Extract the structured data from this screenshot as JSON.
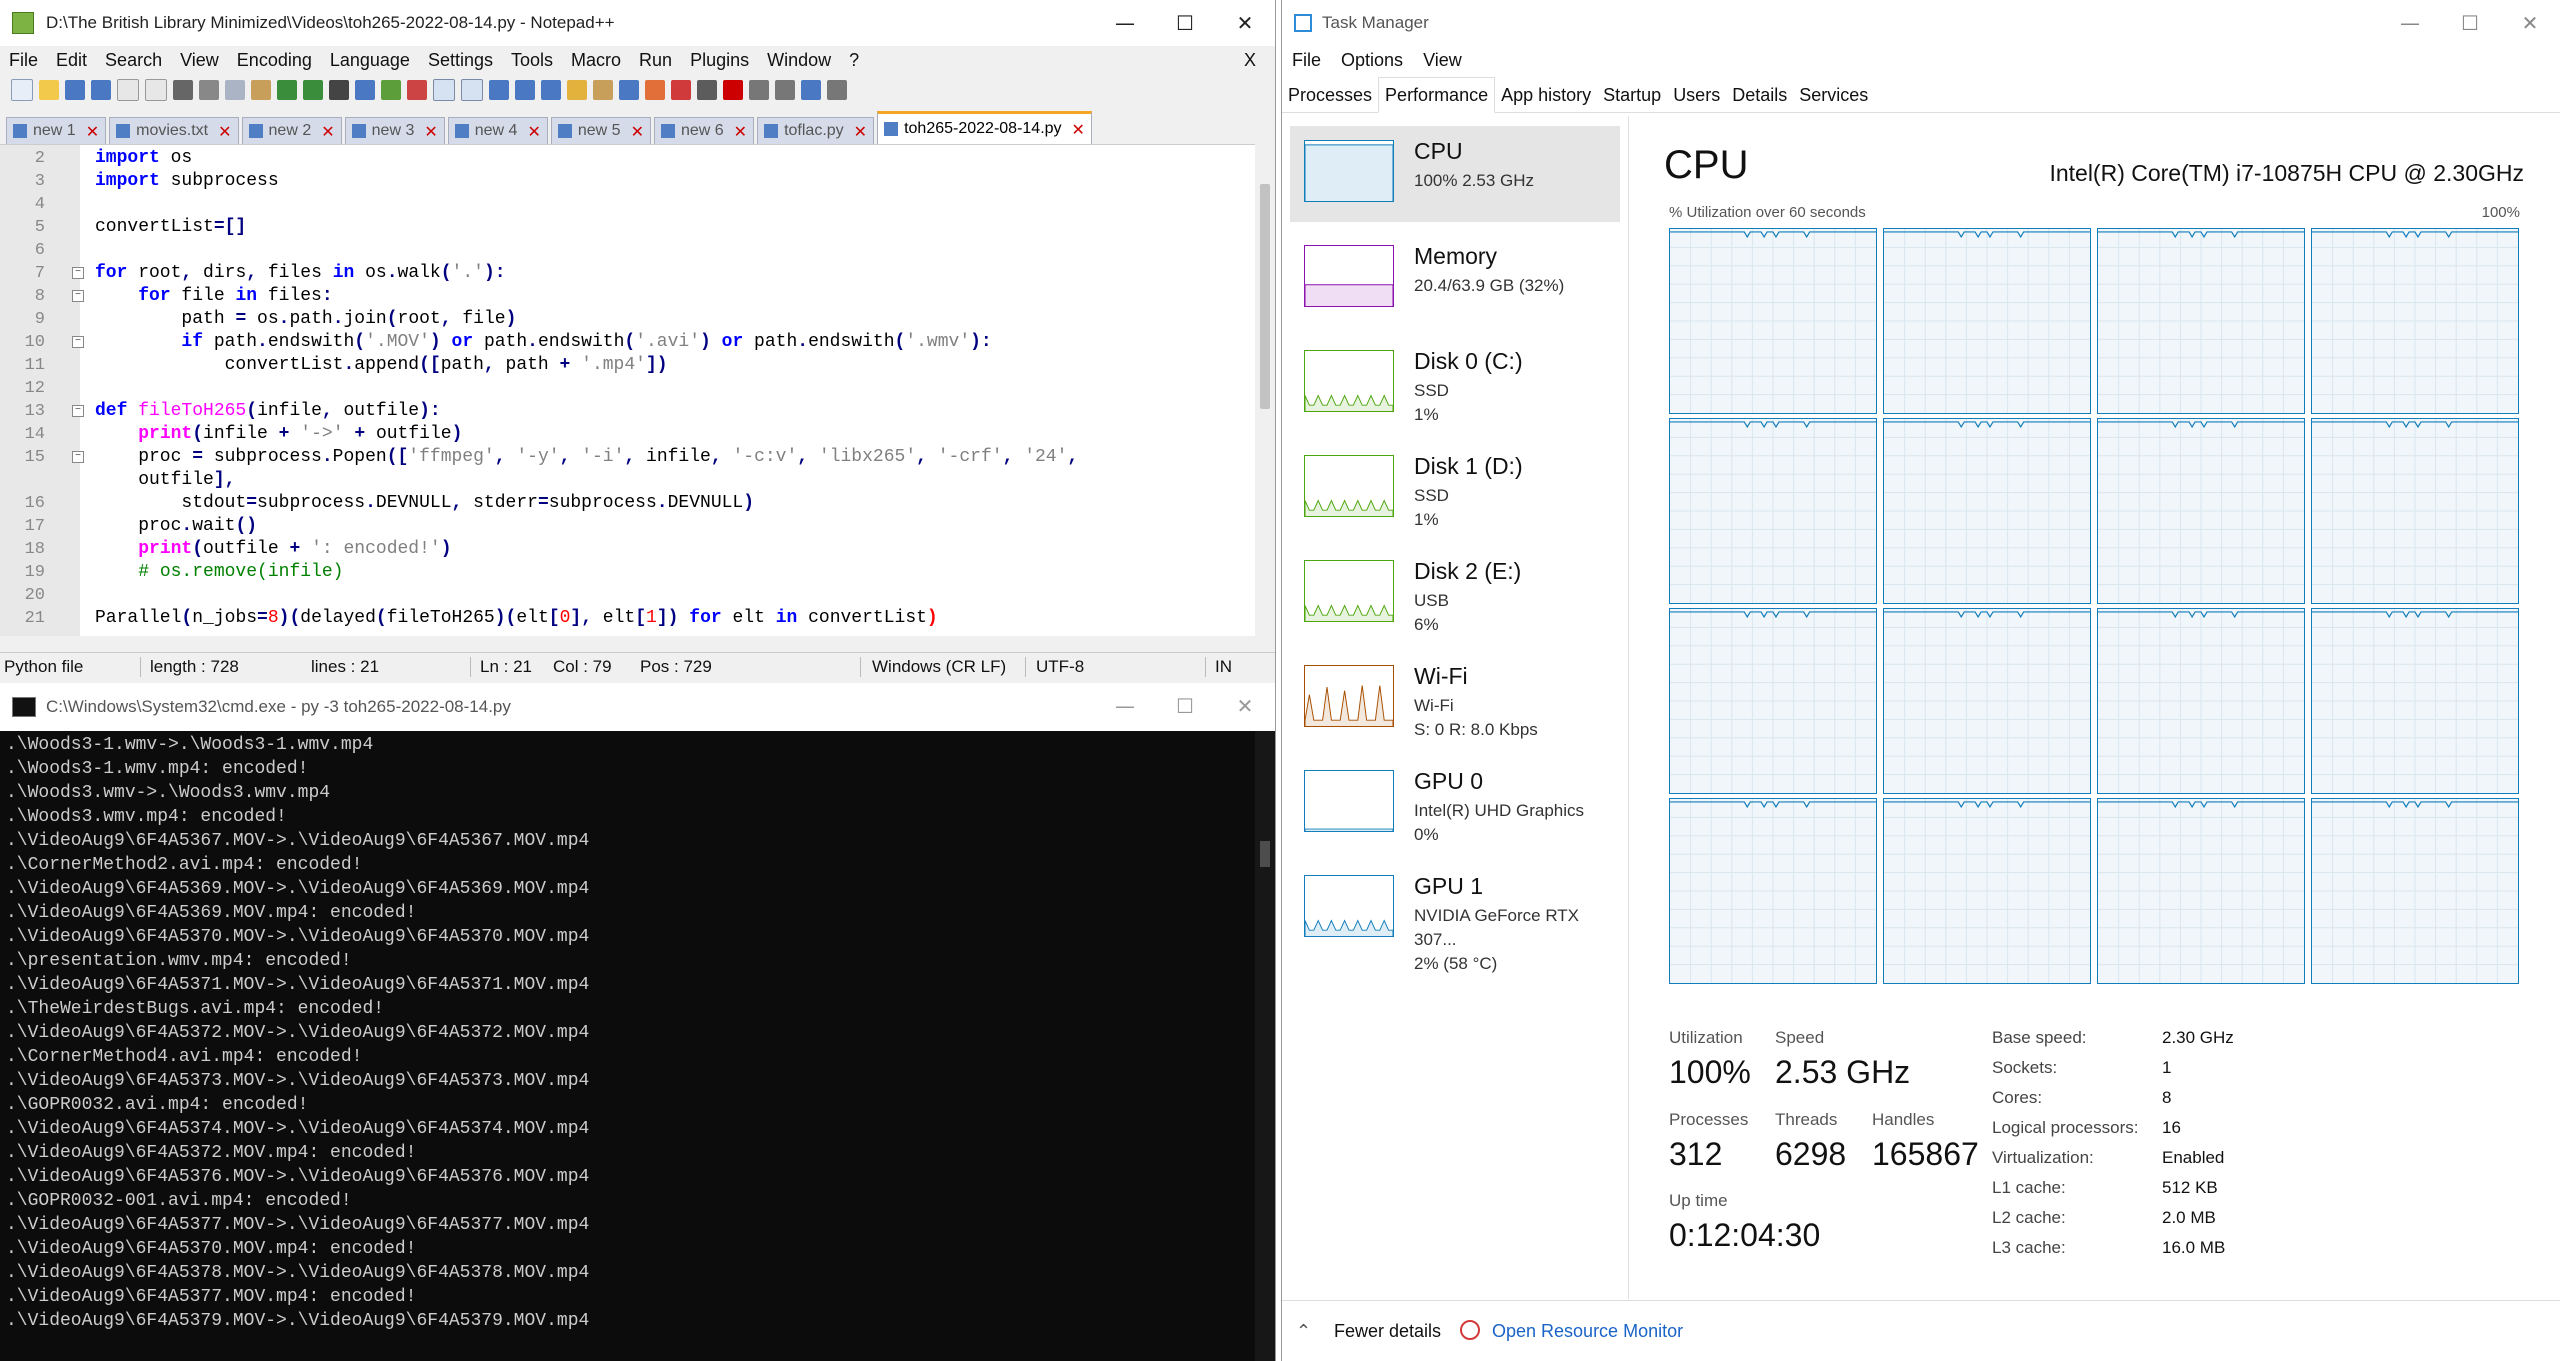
{
  "notepad": {
    "title": "D:\\The British Library Minimized\\Videos\\toh265-2022-08-14.py - Notepad++",
    "menu": [
      "File",
      "Edit",
      "Search",
      "View",
      "Encoding",
      "Language",
      "Settings",
      "Tools",
      "Macro",
      "Run",
      "Plugins",
      "Window",
      "?"
    ],
    "menu_close": "X",
    "tabs": [
      "new 1",
      "movies.txt",
      "new 2",
      "new 3",
      "new 4",
      "new 5",
      "new 6",
      "toflac.py",
      "toh265-2022-08-14.py"
    ],
    "active_tab": "toh265-2022-08-14.py",
    "line_numbers": [
      "2",
      "3",
      "4",
      "5",
      "6",
      "7",
      "8",
      "9",
      "10",
      "11",
      "12",
      "13",
      "14",
      "15",
      "",
      "16",
      "17",
      "18",
      "19",
      "20",
      "21"
    ],
    "status": {
      "filetype": "Python file",
      "length": "length : 728",
      "lines": "lines : 21",
      "ln": "Ln : 21",
      "col": "Col : 79",
      "pos": "Pos : 729",
      "eol": "Windows (CR LF)",
      "encoding": "UTF-8",
      "mode": "IN"
    }
  },
  "cmd": {
    "title": "C:\\Windows\\System32\\cmd.exe - py  -3 toh265-2022-08-14.py",
    "lines": [
      ".\\Woods3-1.wmv->.\\Woods3-1.wmv.mp4",
      ".\\Woods3-1.wmv.mp4: encoded!",
      ".\\Woods3.wmv->.\\Woods3.wmv.mp4",
      ".\\Woods3.wmv.mp4: encoded!",
      ".\\VideoAug9\\6F4A5367.MOV->.\\VideoAug9\\6F4A5367.MOV.mp4",
      ".\\CornerMethod2.avi.mp4: encoded!",
      ".\\VideoAug9\\6F4A5369.MOV->.\\VideoAug9\\6F4A5369.MOV.mp4",
      ".\\VideoAug9\\6F4A5369.MOV.mp4: encoded!",
      ".\\VideoAug9\\6F4A5370.MOV->.\\VideoAug9\\6F4A5370.MOV.mp4",
      ".\\presentation.wmv.mp4: encoded!",
      ".\\VideoAug9\\6F4A5371.MOV->.\\VideoAug9\\6F4A5371.MOV.mp4",
      ".\\TheWeirdestBugs.avi.mp4: encoded!",
      ".\\VideoAug9\\6F4A5372.MOV->.\\VideoAug9\\6F4A5372.MOV.mp4",
      ".\\CornerMethod4.avi.mp4: encoded!",
      ".\\VideoAug9\\6F4A5373.MOV->.\\VideoAug9\\6F4A5373.MOV.mp4",
      ".\\GOPR0032.avi.mp4: encoded!",
      ".\\VideoAug9\\6F4A5374.MOV->.\\VideoAug9\\6F4A5374.MOV.mp4",
      ".\\VideoAug9\\6F4A5372.MOV.mp4: encoded!",
      ".\\VideoAug9\\6F4A5376.MOV->.\\VideoAug9\\6F4A5376.MOV.mp4",
      ".\\GOPR0032-001.avi.mp4: encoded!",
      ".\\VideoAug9\\6F4A5377.MOV->.\\VideoAug9\\6F4A5377.MOV.mp4",
      ".\\VideoAug9\\6F4A5370.MOV.mp4: encoded!",
      ".\\VideoAug9\\6F4A5378.MOV->.\\VideoAug9\\6F4A5378.MOV.mp4",
      ".\\VideoAug9\\6F4A5377.MOV.mp4: encoded!",
      ".\\VideoAug9\\6F4A5379.MOV->.\\VideoAug9\\6F4A5379.MOV.mp4"
    ]
  },
  "taskmgr": {
    "title": "Task Manager",
    "menu": [
      "File",
      "Options",
      "View"
    ],
    "tabs": [
      "Processes",
      "Performance",
      "App history",
      "Startup",
      "Users",
      "Details",
      "Services"
    ],
    "active_tab": "Performance",
    "sidebar": [
      {
        "name": "CPU",
        "sub1": "100%  2.53 GHz",
        "sub2": "",
        "sub3": "",
        "color": "#117dbb"
      },
      {
        "name": "Memory",
        "sub1": "20.4/63.9 GB (32%)",
        "sub2": "",
        "sub3": "",
        "color": "#8b12ae"
      },
      {
        "name": "Disk 0 (C:)",
        "sub1": "SSD",
        "sub2": "1%",
        "sub3": "",
        "color": "#4da60c"
      },
      {
        "name": "Disk 1 (D:)",
        "sub1": "SSD",
        "sub2": "1%",
        "sub3": "",
        "color": "#4da60c"
      },
      {
        "name": "Disk 2 (E:)",
        "sub1": "USB",
        "sub2": "6%",
        "sub3": "",
        "color": "#4da60c"
      },
      {
        "name": "Wi-Fi",
        "sub1": "Wi-Fi",
        "sub2": "S: 0  R: 8.0 Kbps",
        "sub3": "",
        "color": "#a74f01"
      },
      {
        "name": "GPU 0",
        "sub1": "Intel(R) UHD Graphics",
        "sub2": "0%",
        "sub3": "",
        "color": "#117dbb"
      },
      {
        "name": "GPU 1",
        "sub1": "NVIDIA GeForce RTX 307...",
        "sub2": "2%  (58 °C)",
        "sub3": "",
        "color": "#117dbb"
      }
    ],
    "cpu_heading": "CPU",
    "cpu_model": "Intel(R) Core(TM) i7-10875H CPU @ 2.30GHz",
    "util_label": "% Utilization over 60 seconds",
    "util_max": "100%",
    "logical_processors_graphs": 16,
    "stats": {
      "utilization_label": "Utilization",
      "utilization": "100%",
      "speed_label": "Speed",
      "speed": "2.53 GHz",
      "processes_label": "Processes",
      "processes": "312",
      "threads_label": "Threads",
      "threads": "6298",
      "handles_label": "Handles",
      "handles": "165867",
      "uptime_label": "Up time",
      "uptime": "0:12:04:30"
    },
    "info": [
      {
        "k": "Base speed:",
        "v": "2.30 GHz"
      },
      {
        "k": "Sockets:",
        "v": "1"
      },
      {
        "k": "Cores:",
        "v": "8"
      },
      {
        "k": "Logical processors:",
        "v": "16"
      },
      {
        "k": "Virtualization:",
        "v": "Enabled"
      },
      {
        "k": "L1 cache:",
        "v": "512 KB"
      },
      {
        "k": "L2 cache:",
        "v": "2.0 MB"
      },
      {
        "k": "L3 cache:",
        "v": "16.0 MB"
      }
    ],
    "footer": {
      "fewer": "Fewer details",
      "resmon": "Open Resource Monitor"
    }
  },
  "icons": {
    "min": "minimize-icon",
    "max": "maximize-icon",
    "close": "close-icon"
  }
}
